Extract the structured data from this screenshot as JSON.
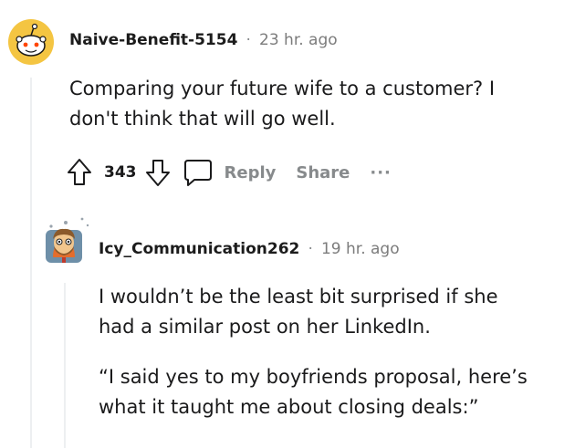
{
  "comment1": {
    "username": "Naive-Benefit-5154",
    "separator": "·",
    "time": "23 hr. ago",
    "text_line1": "Comparing your future wife to a customer? I",
    "text_line2": "don't think that will go well.",
    "votes": "343",
    "reply_label": "Reply",
    "share_label": "Share",
    "more_label": "···",
    "colors": {
      "avatar_bg": "#f4c542",
      "avatar_face": "#ffffff"
    }
  },
  "comment2": {
    "username": "Icy_Communication262",
    "separator": "·",
    "time": "19 hr. ago",
    "para1_line1": "I wouldn’t be the least bit surprised if she",
    "para1_line2": "had a similar post on her LinkedIn.",
    "para2_line1": "“I said yes to my boyfriends proposal, here’s",
    "para2_line2": "what it taught me about closing deals:”",
    "colors": {
      "avatar_bg": "#6e8fa8",
      "hair": "#8b5a2b"
    }
  }
}
